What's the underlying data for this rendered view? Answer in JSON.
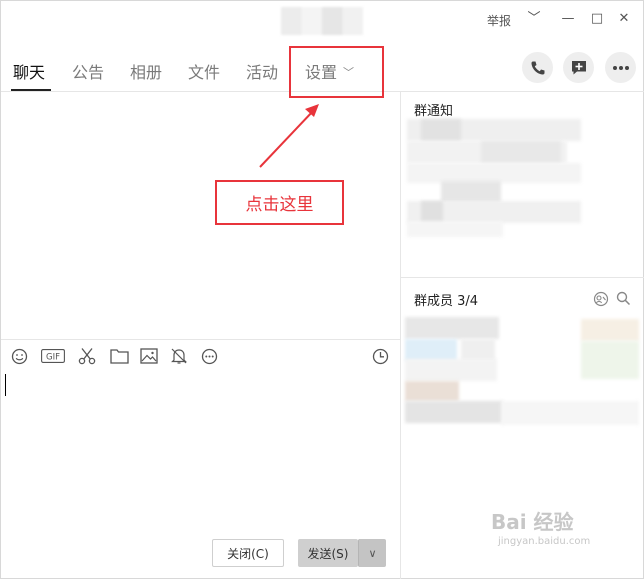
{
  "titlebar": {
    "report_label": "举报",
    "dropdown_glyph": "﹀",
    "minimize_glyph": "—",
    "maximize_glyph": "□",
    "close_glyph": "✕"
  },
  "tabs": [
    {
      "label": "聊天",
      "active": true
    },
    {
      "label": "公告",
      "active": false
    },
    {
      "label": "相册",
      "active": false
    },
    {
      "label": "文件",
      "active": false
    },
    {
      "label": "活动",
      "active": false
    },
    {
      "label": "设置",
      "active": false
    }
  ],
  "settings_chevron": "﹀",
  "header_actions": [
    "phone-icon",
    "new-message-icon",
    "more-icon"
  ],
  "right_panel": {
    "notice_title": "群通知",
    "members_title": "群成员 3/4"
  },
  "toolbar_icons": [
    "emoji-icon",
    "gif-icon",
    "scissors-icon",
    "folder-icon",
    "image-icon",
    "bell-off-icon",
    "more-circle-icon",
    "history-clock-icon"
  ],
  "toolbar_gif_text": "GIF",
  "buttons": {
    "close_label": "关闭(C)",
    "send_label": "发送(S)",
    "send_dropdown_glyph": "∨"
  },
  "annotation": {
    "label": "点击这里",
    "color": "#e8343b"
  },
  "watermark": {
    "main": "Bai 经验",
    "sub": "jingyan.baidu.com"
  }
}
